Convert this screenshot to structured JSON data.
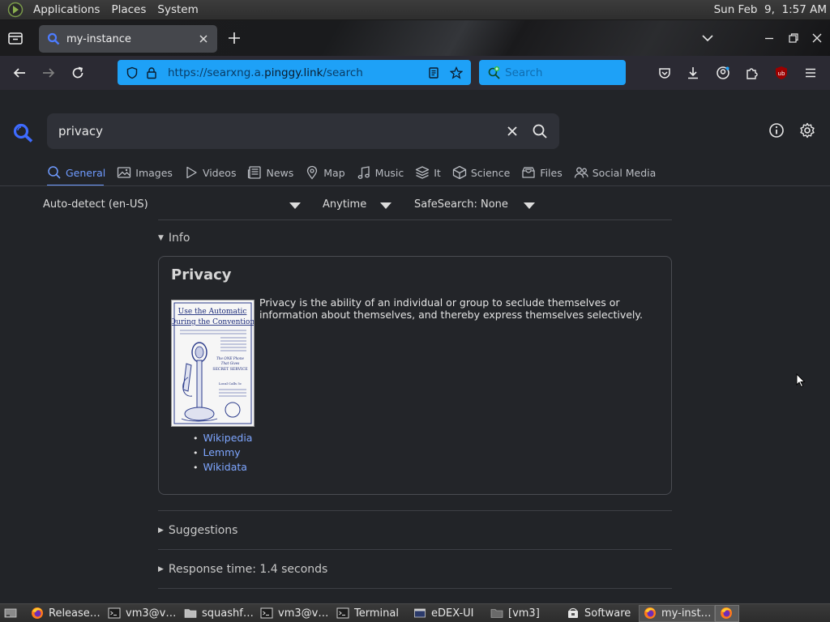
{
  "top_panel": {
    "menus": [
      "Applications",
      "Places",
      "System"
    ],
    "clock": "Sun Feb  9,  1:57 AM"
  },
  "browser": {
    "tab_title": "my-instance",
    "url_prefix": "https://searxng.a.",
    "url_host": "pinggy.link",
    "url_path": "/search",
    "search_placeholder": "Search"
  },
  "page": {
    "query": "privacy",
    "categories": [
      {
        "label": "General",
        "icon": "search-icon",
        "active": true
      },
      {
        "label": "Images",
        "icon": "image-icon"
      },
      {
        "label": "Videos",
        "icon": "play-icon"
      },
      {
        "label": "News",
        "icon": "newspaper-icon"
      },
      {
        "label": "Map",
        "icon": "map-pin-icon"
      },
      {
        "label": "Music",
        "icon": "music-note-icon"
      },
      {
        "label": "It",
        "icon": "layers-icon"
      },
      {
        "label": "Science",
        "icon": "cube-icon"
      },
      {
        "label": "Files",
        "icon": "drawer-icon"
      },
      {
        "label": "Social Media",
        "icon": "people-icon"
      }
    ],
    "filters": {
      "language": "Auto-detect (en-US)",
      "time": "Anytime",
      "safesearch": "SafeSearch: None"
    },
    "info_toggle": "Info",
    "infobox": {
      "title": "Privacy",
      "text": "Privacy is the ability of an individual or group to seclude themselves or information about themselves, and thereby express themselves selectively.",
      "image_caption_lines": [
        "Use the Automatic",
        "During the Convention",
        "The ONE Phone",
        "That Gives",
        "SECRET SERVICE",
        "Local Calls 5c"
      ],
      "links": [
        "Wikipedia",
        "Lemmy",
        "Wikidata"
      ]
    },
    "suggestions_toggle": "Suggestions",
    "response_time": "Response time: 1.4 seconds"
  },
  "taskbar": {
    "items": [
      {
        "label": "Release…",
        "icon": "firefox-icon"
      },
      {
        "label": "vm3@v…",
        "icon": "terminal-icon"
      },
      {
        "label": "squashf…",
        "icon": "folder-icon"
      },
      {
        "label": "vm3@v…",
        "icon": "terminal-icon"
      },
      {
        "label": "Terminal",
        "icon": "terminal-icon"
      },
      {
        "label": "eDEX-UI",
        "icon": "window-icon"
      },
      {
        "label": "[vm3]",
        "icon": "folder-icon"
      },
      {
        "label": "Software",
        "icon": "package-icon"
      },
      {
        "label": "my-inst…",
        "icon": "firefox-icon",
        "active": true
      }
    ]
  },
  "colors": {
    "accent": "#6f9bff",
    "urlbar": "#1ea1f7",
    "page_bg": "#222428"
  }
}
